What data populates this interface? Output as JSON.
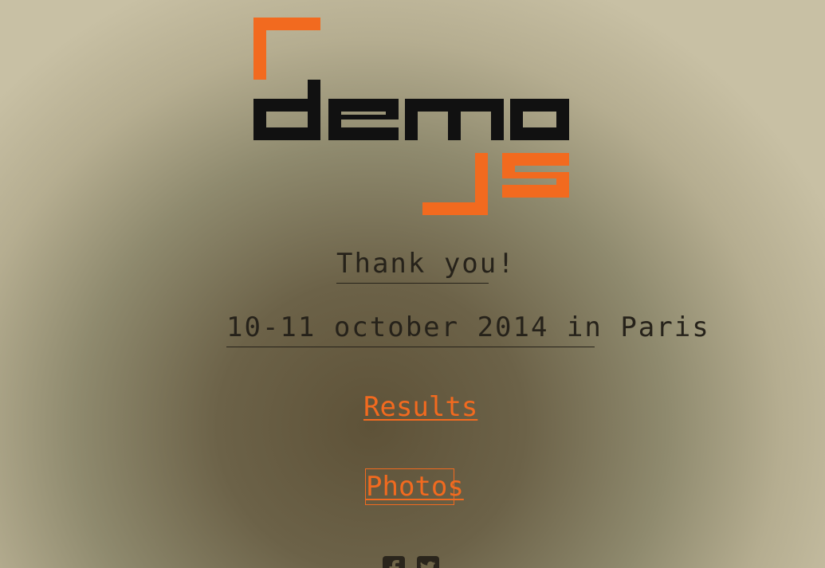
{
  "logo": {
    "word": "demo",
    "accent_glyph": "JS",
    "colors": {
      "accent": "#f26a1f",
      "dark": "#111111"
    }
  },
  "links": {
    "thank_you": "Thank you!",
    "event_date": "10-11 october 2014 in Paris",
    "results": "Results",
    "photos": "Photos"
  },
  "social": [
    {
      "icon": "facebook-icon"
    },
    {
      "icon": "twitter-icon"
    }
  ],
  "colors": {
    "accent": "#f26a1f",
    "text_dark": "#26221a",
    "bg_center": "#5e5238",
    "bg_edge": "#c8c0a4"
  }
}
